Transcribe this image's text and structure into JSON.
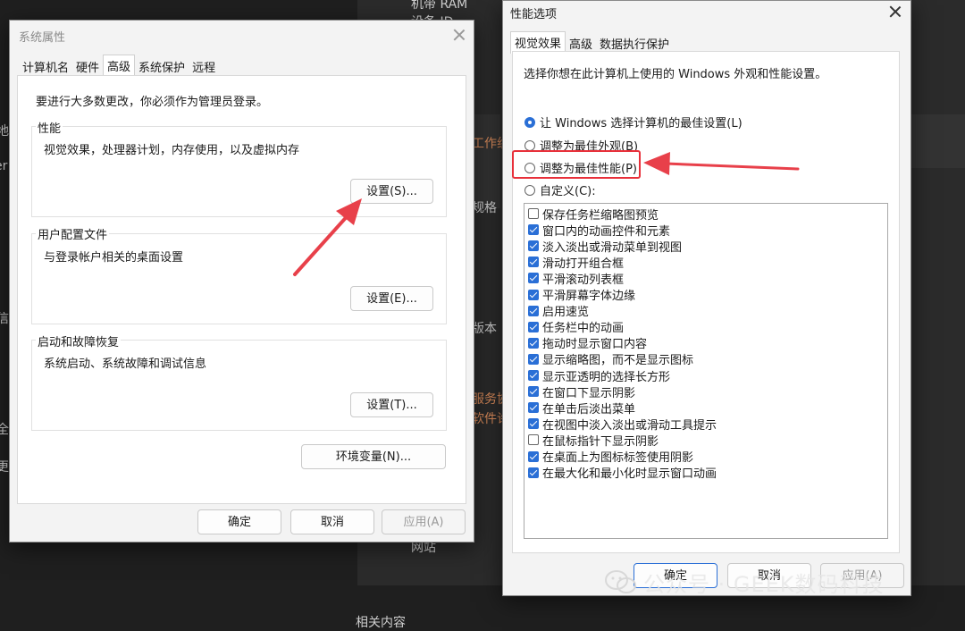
{
  "background": {
    "texts": [
      "机带 RAM",
      "设备 ID",
      "工作组",
      "规格",
      "版本",
      "服务协",
      "软件许",
      "网站",
      "相关内容",
      "地",
      "er",
      "信",
      "全",
      "更"
    ]
  },
  "dialog1": {
    "title": "系统属性",
    "tabs": [
      "计算机名",
      "硬件",
      "高级",
      "系统保护",
      "远程"
    ],
    "active_tab": "高级",
    "admin_note": "要进行大多数更改，你必须作为管理员登录。",
    "performance": {
      "title": "性能",
      "description": "视觉效果，处理器计划，内存使用，以及虚拟内存",
      "button": "设置(S)..."
    },
    "user_profiles": {
      "title": "用户配置文件",
      "description": "与登录帐户相关的桌面设置",
      "button": "设置(E)..."
    },
    "startup_recovery": {
      "title": "启动和故障恢复",
      "description": "系统启动、系统故障和调试信息",
      "button": "设置(T)..."
    },
    "env_button": "环境变量(N)...",
    "ok": "确定",
    "cancel": "取消",
    "apply": "应用(A)"
  },
  "dialog2": {
    "title": "性能选项",
    "tabs": [
      "视觉效果",
      "高级",
      "数据执行保护"
    ],
    "active_tab": "视觉效果",
    "intro": "选择你想在此计算机上使用的 Windows 外观和性能设置。",
    "options": [
      {
        "label": "让 Windows 选择计算机的最佳设置(L)",
        "checked": true
      },
      {
        "label": "调整为最佳外观(B)",
        "checked": false
      },
      {
        "label": "调整为最佳性能(P)",
        "checked": false
      },
      {
        "label": "自定义(C):",
        "checked": false
      }
    ],
    "effects": [
      {
        "label": "保存任务栏缩略图预览",
        "checked": false
      },
      {
        "label": "窗口内的动画控件和元素",
        "checked": true
      },
      {
        "label": "淡入淡出或滑动菜单到视图",
        "checked": true
      },
      {
        "label": "滑动打开组合框",
        "checked": true
      },
      {
        "label": "平滑滚动列表框",
        "checked": true
      },
      {
        "label": "平滑屏幕字体边缘",
        "checked": true
      },
      {
        "label": "启用速览",
        "checked": true
      },
      {
        "label": "任务栏中的动画",
        "checked": true
      },
      {
        "label": "拖动时显示窗口内容",
        "checked": true
      },
      {
        "label": "显示缩略图，而不是显示图标",
        "checked": true
      },
      {
        "label": "显示亚透明的选择长方形",
        "checked": true
      },
      {
        "label": "在窗口下显示阴影",
        "checked": true
      },
      {
        "label": "在单击后淡出菜单",
        "checked": true
      },
      {
        "label": "在视图中淡入淡出或滑动工具提示",
        "checked": true
      },
      {
        "label": "在鼠标指针下显示阴影",
        "checked": false
      },
      {
        "label": "在桌面上为图标标签使用阴影",
        "checked": true
      },
      {
        "label": "在最大化和最小化时显示窗口动画",
        "checked": true
      }
    ],
    "ok": "确定",
    "cancel": "取消",
    "apply": "应用(A)"
  },
  "annotation_color": "#e8303a",
  "watermark": "公众号 · GEEK数码科技"
}
